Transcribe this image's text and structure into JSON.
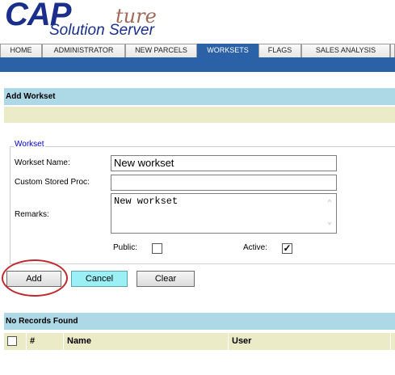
{
  "logo": {
    "cap": "CAP",
    "ture": "ture",
    "subtitle": "Solution Server"
  },
  "nav": [
    "HOME",
    "ADMINISTRATOR",
    "NEW PARCELS",
    "WORKSETS",
    "FLAGS",
    "SALES ANALYSIS"
  ],
  "nav_active": "WORKSETS",
  "section_title": "Add Workset",
  "form": {
    "legend": "Workset",
    "workset_name_label": "Workset Name:",
    "workset_name_value": "New workset",
    "stored_proc_label": "Custom Stored Proc:",
    "stored_proc_value": "",
    "remarks_label": "Remarks:",
    "remarks_value": "New workset",
    "public_label": "Public:",
    "public_checked": false,
    "active_label": "Active:",
    "active_checked": true
  },
  "buttons": {
    "add": "Add",
    "cancel": "Cancel",
    "clear": "Clear"
  },
  "results": {
    "status": "No Records Found",
    "columns": [
      "#",
      "Name",
      "User"
    ]
  },
  "colors": {
    "nav_active": "#2b61a6",
    "section_bar": "#add8e6",
    "tan_bar": "#ecebc8",
    "cancel_button": "#9af0f5",
    "highlight_circle": "#c0282e"
  }
}
